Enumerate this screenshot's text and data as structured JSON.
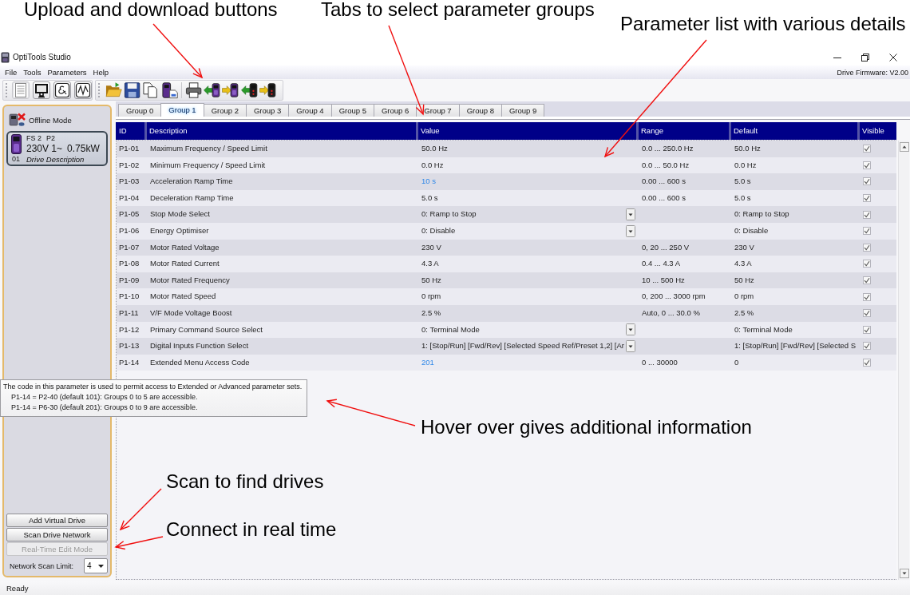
{
  "annotations": [
    {
      "text": "Upload and download buttons"
    },
    {
      "text": "Tabs to select parameter groups"
    },
    {
      "text": "Parameter list with various details"
    },
    {
      "text": "Hover over gives additional information"
    },
    {
      "text": "Scan to find drives"
    },
    {
      "text": "Connect in real time"
    }
  ],
  "window": {
    "title": "OptiTools Studio"
  },
  "menu": [
    "File",
    "Tools",
    "Parameters",
    "Help"
  ],
  "firmware": "Drive Firmware: V2.00",
  "view_buttons": [
    {
      "selected": true
    },
    {
      "selected": false
    },
    {
      "selected": false
    },
    {
      "selected": false
    }
  ],
  "sidebar": {
    "mode": "Offline Mode",
    "drive": {
      "model_info": [
        "FS 2",
        "P2"
      ],
      "rating": [
        "230V 1~",
        "0.75kW"
      ],
      "address": "01",
      "description": "Drive Description"
    },
    "buttons": [
      {
        "label": "Add Virtual Drive",
        "disabled": false
      },
      {
        "label": "Scan Drive Network",
        "disabled": false
      },
      {
        "label": "Real-Time Edit Mode",
        "disabled": true
      }
    ],
    "scan_limit": {
      "label": "Network Scan Limit:",
      "value": "4"
    }
  },
  "tabs": [
    {
      "label": "Group 0",
      "selected": false
    },
    {
      "label": "Group 1",
      "selected": true
    },
    {
      "label": "Group 2",
      "selected": false
    },
    {
      "label": "Group 3",
      "selected": false
    },
    {
      "label": "Group 4",
      "selected": false
    },
    {
      "label": "Group 5",
      "selected": false
    },
    {
      "label": "Group 6",
      "selected": false
    },
    {
      "label": "Group 7",
      "selected": false
    },
    {
      "label": "Group 8",
      "selected": false
    },
    {
      "label": "Group 9",
      "selected": false
    }
  ],
  "table": {
    "columns": [
      "ID",
      "Description",
      "Value",
      "Range",
      "Default",
      "Visible"
    ],
    "rows": [
      {
        "id": "P1-01",
        "description": "Maximum Frequency / Speed Limit",
        "kind": "number",
        "value": "50.0 Hz",
        "modified": false,
        "range": "0.0 ... 250.0 Hz",
        "default": "50.0 Hz",
        "visible": true
      },
      {
        "id": "P1-02",
        "description": "Minimum Frequency / Speed Limit",
        "kind": "number",
        "value": "0.0 Hz",
        "modified": false,
        "range": "0.0 ... 50.0 Hz",
        "default": "0.0 Hz",
        "visible": true
      },
      {
        "id": "P1-03",
        "description": "Acceleration Ramp Time",
        "kind": "number",
        "value": "10 s",
        "modified": true,
        "range": "0.00 ... 600 s",
        "default": "5.0 s",
        "visible": true
      },
      {
        "id": "P1-04",
        "description": "Deceleration Ramp Time",
        "kind": "number",
        "value": "5.0 s",
        "modified": false,
        "range": "0.00 ... 600 s",
        "default": "5.0 s",
        "visible": true
      },
      {
        "id": "P1-05",
        "description": "Stop Mode Select",
        "kind": "dropdown",
        "value": "0: Ramp to Stop",
        "modified": false,
        "default": "0: Ramp to Stop",
        "visible": true
      },
      {
        "id": "P1-06",
        "description": "Energy Optimiser",
        "kind": "dropdown",
        "value": "0: Disable",
        "modified": false,
        "default": "0: Disable",
        "visible": true
      },
      {
        "id": "P1-07",
        "description": "Motor Rated Voltage",
        "kind": "number",
        "value": "230 V",
        "modified": false,
        "range": "0, 20 ... 250 V",
        "default": "230 V",
        "visible": true
      },
      {
        "id": "P1-08",
        "description": "Motor Rated Current",
        "kind": "number",
        "value": "4.3 A",
        "modified": false,
        "range": "0.4 ... 4.3 A",
        "default": "4.3 A",
        "visible": true
      },
      {
        "id": "P1-09",
        "description": "Motor Rated Frequency",
        "kind": "number",
        "value": "50 Hz",
        "modified": false,
        "range": "10 ... 500 Hz",
        "default": "50 Hz",
        "visible": true
      },
      {
        "id": "P1-10",
        "description": "Motor Rated Speed",
        "kind": "number",
        "value": "0 rpm",
        "modified": false,
        "range": "0, 200 ... 3000 rpm",
        "default": "0 rpm",
        "visible": true
      },
      {
        "id": "P1-11",
        "description": "V/F Mode Voltage Boost",
        "kind": "number",
        "value": "2.5 %",
        "modified": false,
        "range": "Auto, 0 ... 30.0 %",
        "default": "2.5 %",
        "visible": true
      },
      {
        "id": "P1-12",
        "description": "Primary Command Source Select",
        "kind": "dropdown",
        "value": "0: Terminal Mode",
        "modified": false,
        "default": "0: Terminal Mode",
        "visible": true
      },
      {
        "id": "P1-13",
        "description": "Digital Inputs Function Select",
        "kind": "dropdown",
        "value": "1: [Stop/Run] [Fwd/Rev] [Selected Speed Ref/Preset 1,2] [Ar",
        "modified": false,
        "default": "1: [Stop/Run] [Fwd/Rev] [Selected S",
        "visible": true
      },
      {
        "id": "P1-14",
        "description": "Extended Menu Access Code",
        "kind": "number",
        "value": "201",
        "modified": true,
        "range": "0 ... 30000",
        "default": "0",
        "visible": true
      }
    ]
  },
  "tooltip": {
    "text": "The code in this parameter is used to permit access to Extended or Advanced parameter sets.",
    "details": [
      "P1-14 = P2-40 (default 101): Groups 0 to 5 are accessible.",
      "P1-14 = P6-30 (default 201): Groups 0 to 9 are accessible."
    ]
  },
  "status_bar": "Ready"
}
